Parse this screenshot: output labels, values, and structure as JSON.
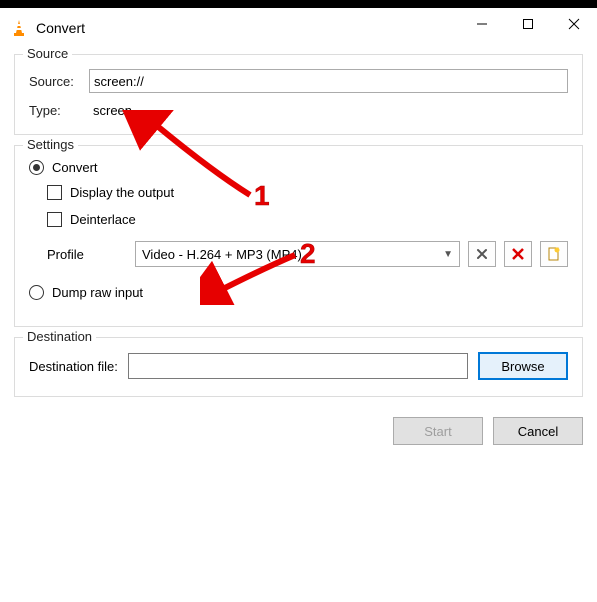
{
  "window": {
    "title": "Convert"
  },
  "source": {
    "legend": "Source",
    "source_label": "Source:",
    "source_value": "screen://",
    "type_label": "Type:",
    "type_value": "screen"
  },
  "settings": {
    "legend": "Settings",
    "convert_label": "Convert",
    "display_output_label": "Display the output",
    "deinterlace_label": "Deinterlace",
    "profile_label": "Profile",
    "profile_value": "Video - H.264 + MP3 (MP4)",
    "dump_raw_label": "Dump raw input"
  },
  "destination": {
    "legend": "Destination",
    "file_label": "Destination file:",
    "file_value": "",
    "browse_label": "Browse"
  },
  "footer": {
    "start_label": "Start",
    "cancel_label": "Cancel"
  },
  "annotations": {
    "one": "1",
    "two": "2"
  }
}
